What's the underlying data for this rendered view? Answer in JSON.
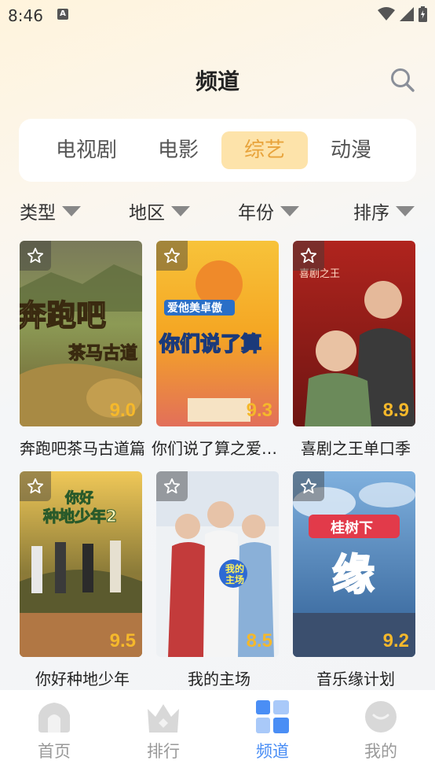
{
  "status": {
    "time": "8:46",
    "a_badge": "A"
  },
  "header": {
    "title": "频道"
  },
  "tabs": [
    {
      "label": "电视剧",
      "active": false
    },
    {
      "label": "电影",
      "active": false
    },
    {
      "label": "综艺",
      "active": true
    },
    {
      "label": "动漫",
      "active": false
    }
  ],
  "filters": [
    {
      "label": "类型"
    },
    {
      "label": "地区"
    },
    {
      "label": "年份"
    },
    {
      "label": "排序"
    }
  ],
  "shows": [
    {
      "title": "奔跑吧茶马古道篇",
      "rating": "9.0",
      "poster_text_1": "奔跑吧",
      "poster_text_2": "茶马古道"
    },
    {
      "title": "你们说了算之爱他美卓傲",
      "rating": "9.3",
      "poster_text_1": "爱他美卓傲",
      "poster_text_2": "你们说了算"
    },
    {
      "title": "喜剧之王单口季",
      "rating": "8.9",
      "poster_text_1": "喜剧之王",
      "poster_text_2": ""
    },
    {
      "title": "你好种地少年",
      "rating": "9.5",
      "poster_text_1": "你好",
      "poster_text_2": "种地少年2"
    },
    {
      "title": "我的主场",
      "rating": "8.5",
      "poster_text_1": "我的",
      "poster_text_2": "主场"
    },
    {
      "title": "音乐缘计划",
      "rating": "9.2",
      "poster_text_1": "桂树下",
      "poster_text_2": "缘"
    }
  ],
  "nav": [
    {
      "label": "首页",
      "active": false
    },
    {
      "label": "排行",
      "active": false
    },
    {
      "label": "频道",
      "active": true
    },
    {
      "label": "我的",
      "active": false
    }
  ],
  "colors": {
    "accent": "#e8a33b",
    "tab_active_bg": "#fde3aa",
    "rating": "#f5b82b",
    "nav_active": "#4a8ef5"
  }
}
